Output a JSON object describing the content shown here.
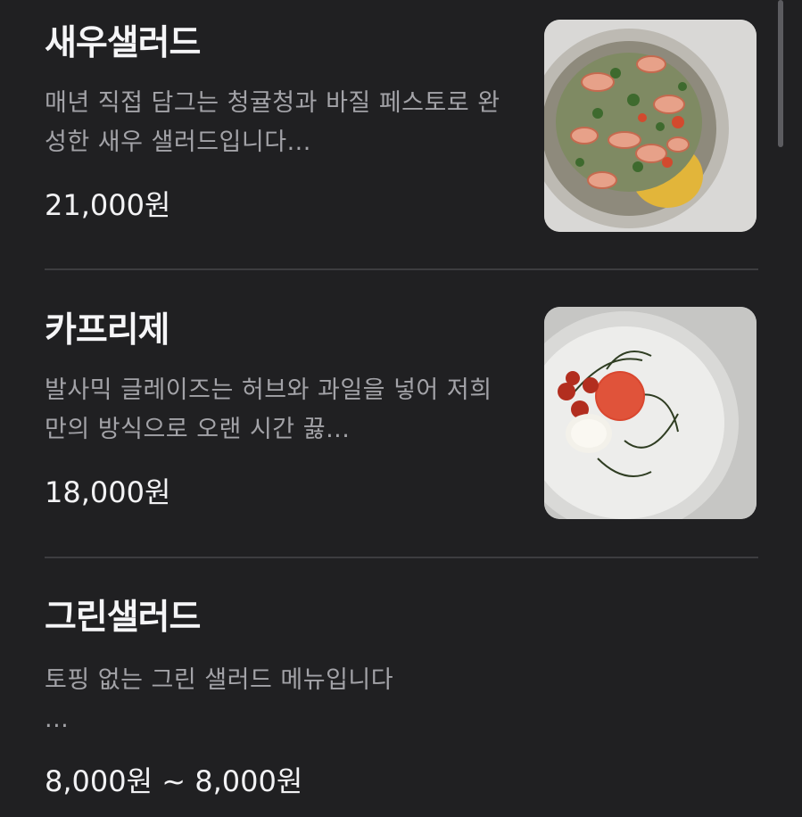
{
  "menu": {
    "items": [
      {
        "name": "새우샐러드",
        "description": "매년 직접 담그는 청귤청과 바질 페스토로 완성한 새우 샐러드입니다...",
        "price": "21,000원",
        "image_alt": "새우샐러드 사진"
      },
      {
        "name": "카프리제",
        "description": "발사믹 글레이즈는 허브와 과일을 넣어 저희만의 방식으로 오랜 시간 끓...",
        "price": "18,000원",
        "image_alt": "카프리제 사진"
      },
      {
        "name": "그린샐러드",
        "description_line1": "토핑 없는 그린 샐러드 메뉴입니다",
        "description_line2": "...",
        "price": "8,000원 ~ 8,000원"
      }
    ]
  },
  "colors": {
    "background": "#202022",
    "title": "#f5f5f7",
    "description": "#a3a3a8",
    "divider": "#3d3d40"
  }
}
